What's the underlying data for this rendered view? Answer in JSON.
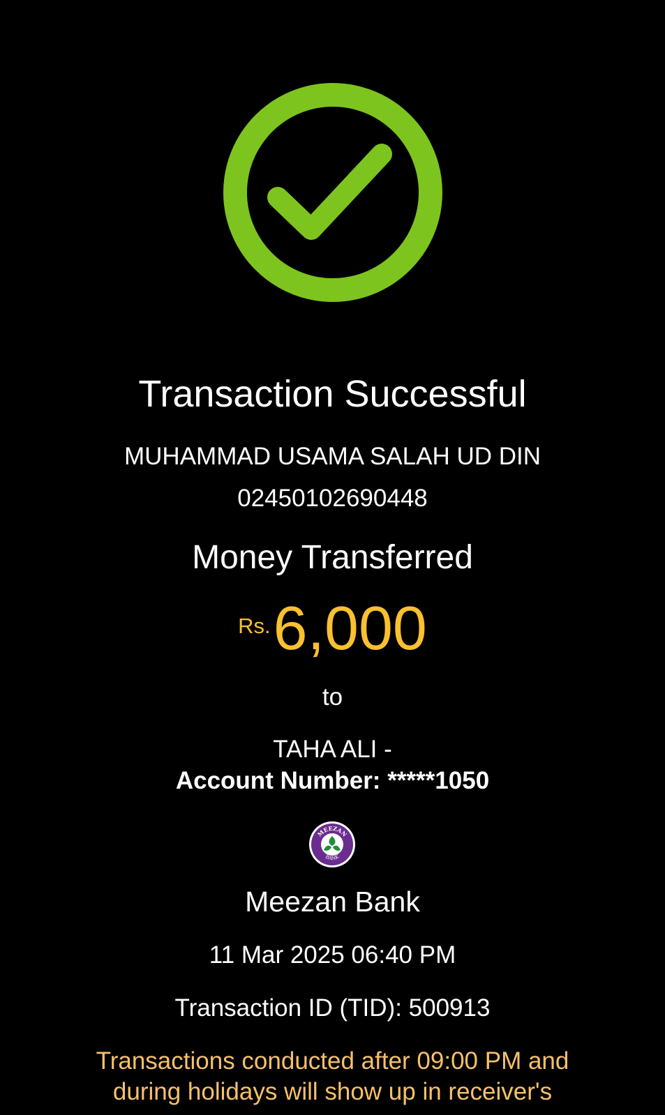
{
  "colors": {
    "background": "#000000",
    "success_green": "#7ec41e",
    "amount_yellow": "#f9c02f",
    "notice_orange": "#f7c16b",
    "text_white": "#ffffff",
    "bank_purple": "#6b2c8f"
  },
  "status": {
    "icon": "check-circle-icon",
    "title": "Transaction Successful"
  },
  "sender": {
    "name": "MUHAMMAD USAMA SALAH UD DIN",
    "account": "02450102690448"
  },
  "transfer": {
    "label": "Money Transferred",
    "currency": "Rs.",
    "amount": "6,000",
    "connector": "to"
  },
  "receiver": {
    "name": "TAHA ALI -",
    "account_line": "Account Number: *****1050"
  },
  "bank": {
    "logo_icon": "meezan-bank-logo",
    "logo_text_top": "MEEZAN",
    "logo_text_bottom": "BANK",
    "name": "Meezan Bank"
  },
  "details": {
    "datetime": "11 Mar 2025 06:40 PM",
    "transaction_id": "Transaction ID (TID): 500913"
  },
  "notice": {
    "line1": "Transactions conducted after 09:00 PM and",
    "line2": "during holidays will show up in receiver's"
  }
}
